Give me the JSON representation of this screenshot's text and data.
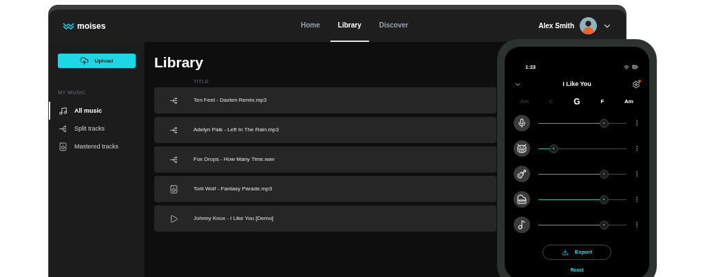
{
  "app": {
    "logo": "moises",
    "nav": [
      {
        "label": "Home",
        "selected": false
      },
      {
        "label": "Library",
        "selected": true
      },
      {
        "label": "Discover",
        "selected": false
      }
    ],
    "user": {
      "name": "Alex Smith"
    }
  },
  "sidebar": {
    "upload": "Upload",
    "section": "MY MUSIC",
    "items": [
      {
        "label": "All music",
        "kind": "music",
        "selected": true
      },
      {
        "label": "Split tracks",
        "kind": "split",
        "selected": false
      },
      {
        "label": "Mastered tracks",
        "kind": "mastered",
        "selected": false
      }
    ]
  },
  "library": {
    "title": "Library",
    "column": "TITLE",
    "rows": [
      {
        "title": "Ten Feet - Daxten Remix.mp3",
        "kind": "split"
      },
      {
        "title": "Adelyn Paik - Left In The Rain.mp3",
        "kind": "split"
      },
      {
        "title": "Fox Drops - How Many Time.wav",
        "kind": "split"
      },
      {
        "title": "Torii Wolf - Fantasy Parade.mp3",
        "kind": "mastered"
      },
      {
        "title": "Johnny Knox - I Like You [Demo]",
        "kind": "play"
      }
    ]
  },
  "phone": {
    "time": "1:23",
    "title": "I Like You",
    "chords": [
      {
        "label": "Am",
        "played": true,
        "selected": false
      },
      {
        "label": "C",
        "played": true,
        "selected": false
      },
      {
        "label": "G",
        "played": false,
        "selected": true
      },
      {
        "label": "F",
        "played": false,
        "selected": false
      },
      {
        "label": "Am",
        "played": false,
        "selected": false
      }
    ],
    "stems": [
      {
        "kind": "vocals",
        "level": 0.74
      },
      {
        "kind": "drums",
        "level": 0.17
      },
      {
        "kind": "bass",
        "level": 0.74
      },
      {
        "kind": "piano",
        "level": 0.74
      },
      {
        "kind": "other",
        "level": 0.74
      }
    ],
    "export": "Export",
    "reset": "Reset"
  }
}
